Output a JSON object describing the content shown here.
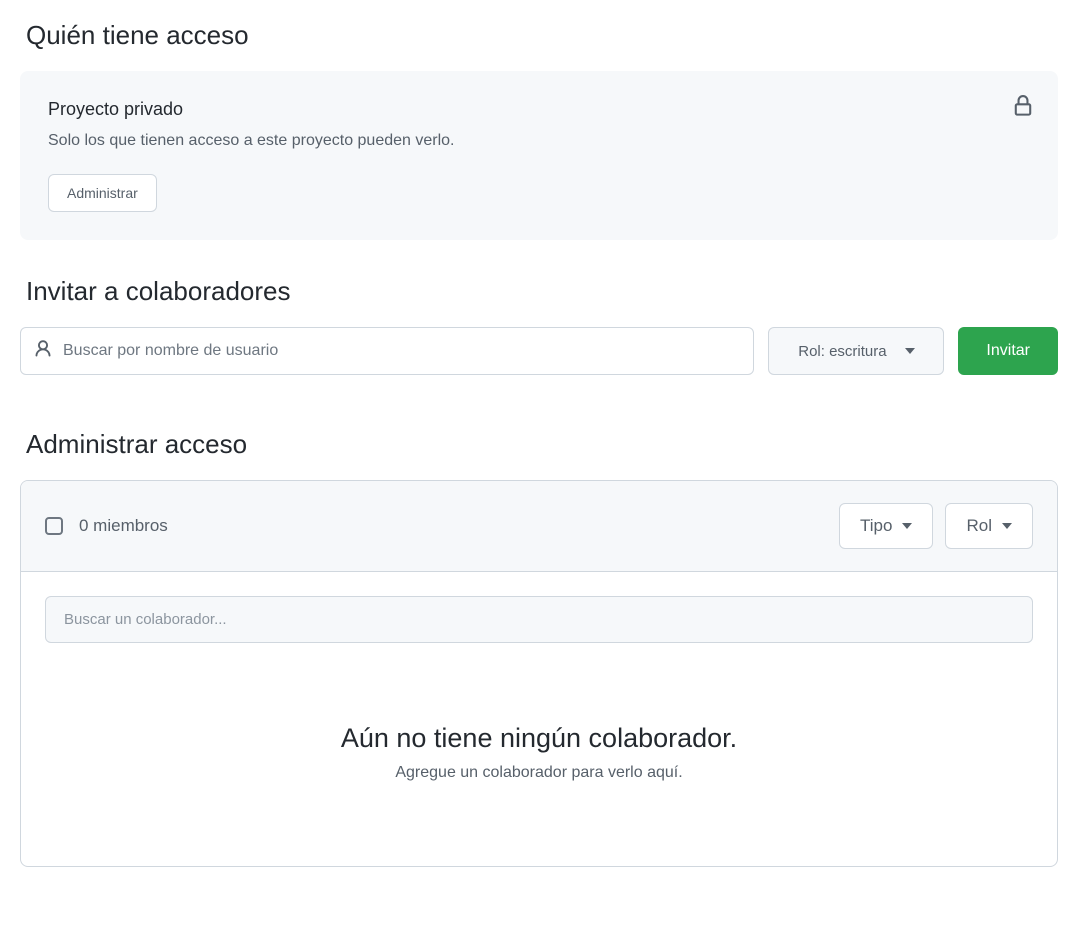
{
  "access": {
    "section_title": "Quién tiene acceso",
    "card_title": "Proyecto privado",
    "card_desc": "Solo los que tienen acceso a este proyecto pueden verlo.",
    "manage_button": "Administrar"
  },
  "invite": {
    "section_title": "Invitar a colaboradores",
    "search_placeholder": "Buscar por nombre de usuario",
    "role_label": "Rol: escritura",
    "invite_button": "Invitar"
  },
  "manage": {
    "section_title": "Administrar acceso",
    "members_label": "0 miembros",
    "type_filter": "Tipo",
    "role_filter": "Rol",
    "collab_search_placeholder": "Buscar un colaborador...",
    "empty_title": "Aún no tiene ningún colaborador.",
    "empty_sub": "Agregue un colaborador para verlo aquí."
  }
}
